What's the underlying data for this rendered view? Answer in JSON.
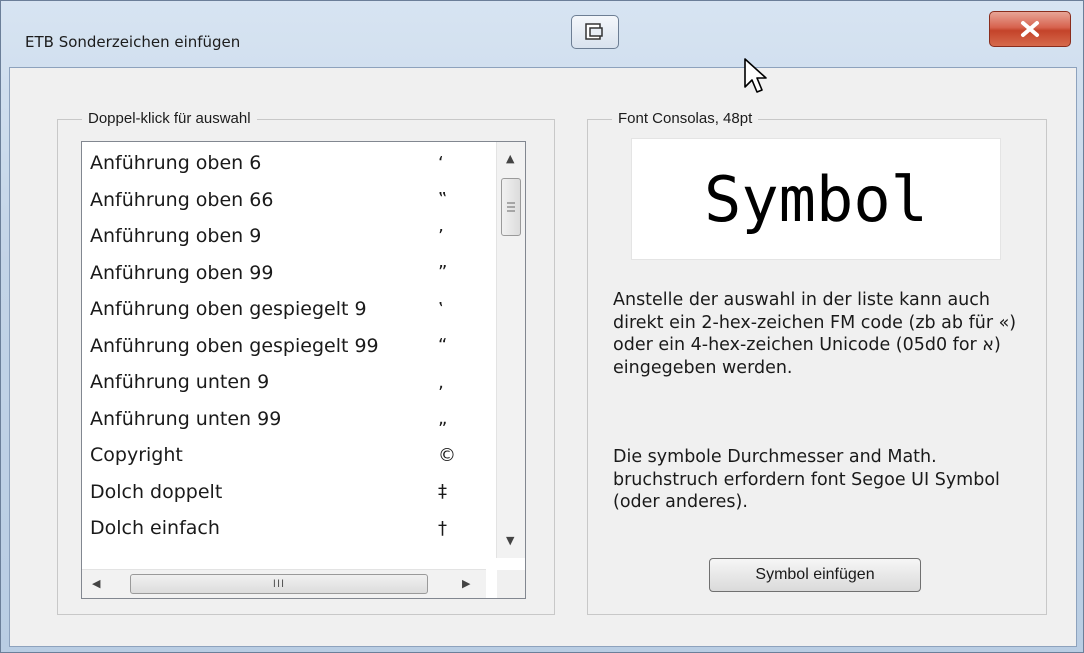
{
  "window": {
    "title": "ETB Sonderzeichen einfügen",
    "close_label": "X"
  },
  "list_group": {
    "legend": "Doppel-klick für auswahl",
    "items": [
      {
        "name": "Anführung oben 6",
        "symbol": "‘"
      },
      {
        "name": "Anführung oben 66",
        "symbol": "‟"
      },
      {
        "name": "Anführung oben 9",
        "symbol": "’"
      },
      {
        "name": "Anführung oben 99",
        "symbol": "”"
      },
      {
        "name": "Anführung oben gespiegelt 9",
        "symbol": "‛"
      },
      {
        "name": "Anführung oben gespiegelt 99",
        "symbol": "“"
      },
      {
        "name": "Anführung unten 9",
        "symbol": "‚"
      },
      {
        "name": "Anführung unten 99",
        "symbol": "„"
      },
      {
        "name": "Copyright",
        "symbol": "©"
      },
      {
        "name": "Dolch doppelt",
        "symbol": "‡"
      },
      {
        "name": "Dolch einfach",
        "symbol": "†"
      }
    ],
    "hscroll_grip": "III"
  },
  "preview_group": {
    "legend": "Font Consolas, 48pt",
    "preview_text": "Symbol",
    "description1": "Anstelle der auswahl in der liste kann auch direkt ein 2-hex-zeichen FM code (zb ab für «) oder ein 4-hex-zeichen Unicode (05d0 for א) eingegeben werden.",
    "description2": "Die symbole Durchmesser and Math. bruchstruch erfordern font Segoe UI Symbol (oder anderes).",
    "insert_button": "Symbol einfügen"
  },
  "colors": {
    "close_red": "#c4432a",
    "dialog_bg": "#f0f0f0"
  }
}
